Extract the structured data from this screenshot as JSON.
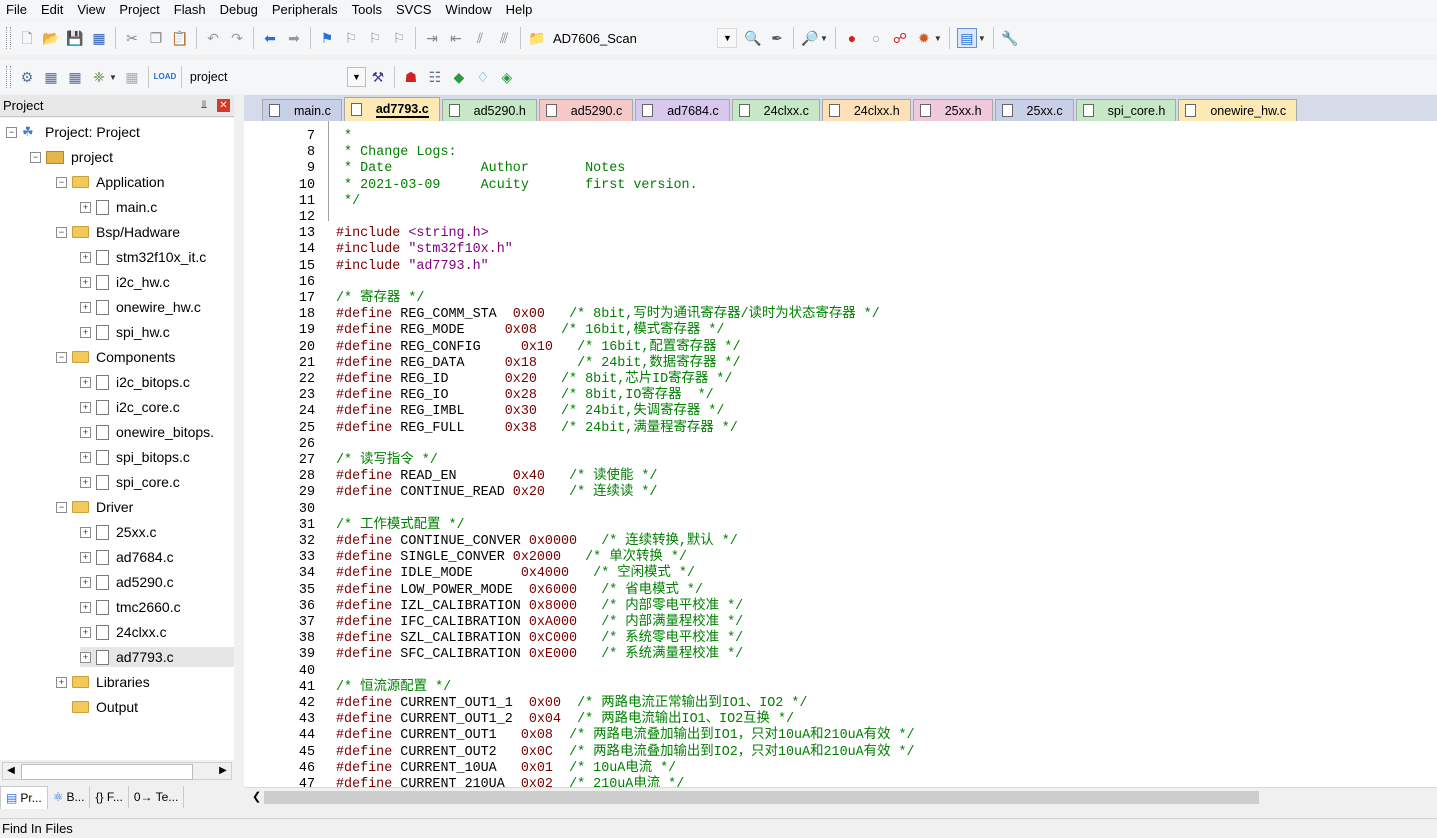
{
  "menu": [
    "File",
    "Edit",
    "View",
    "Project",
    "Flash",
    "Debug",
    "Peripherals",
    "Tools",
    "SVCS",
    "Window",
    "Help"
  ],
  "toolbar1": {
    "target_combo": "AD7606_Scan"
  },
  "toolbar2": {
    "project_combo": "project"
  },
  "project_panel": {
    "title": "Project",
    "pin": "҉",
    "close": "✕",
    "tree": [
      {
        "label": "Project: Project",
        "level": 0,
        "kind": "proj",
        "exp": "−"
      },
      {
        "label": "project",
        "level": 1,
        "kind": "group",
        "exp": "−"
      },
      {
        "label": "Application",
        "level": 2,
        "kind": "folder",
        "exp": "−"
      },
      {
        "label": "main.c",
        "level": 3,
        "kind": "file",
        "exp": "+"
      },
      {
        "label": "Bsp/Hadware",
        "level": 2,
        "kind": "folder",
        "exp": "−"
      },
      {
        "label": "stm32f10x_it.c",
        "level": 3,
        "kind": "file",
        "exp": "+"
      },
      {
        "label": "i2c_hw.c",
        "level": 3,
        "kind": "file",
        "exp": "+"
      },
      {
        "label": "onewire_hw.c",
        "level": 3,
        "kind": "file",
        "exp": "+"
      },
      {
        "label": "spi_hw.c",
        "level": 3,
        "kind": "file",
        "exp": "+"
      },
      {
        "label": "Components",
        "level": 2,
        "kind": "folder",
        "exp": "−"
      },
      {
        "label": "i2c_bitops.c",
        "level": 3,
        "kind": "file",
        "exp": "+"
      },
      {
        "label": "i2c_core.c",
        "level": 3,
        "kind": "file",
        "exp": "+"
      },
      {
        "label": "onewire_bitops.",
        "level": 3,
        "kind": "file",
        "exp": "+"
      },
      {
        "label": "spi_bitops.c",
        "level": 3,
        "kind": "file",
        "exp": "+"
      },
      {
        "label": "spi_core.c",
        "level": 3,
        "kind": "file",
        "exp": "+"
      },
      {
        "label": "Driver",
        "level": 2,
        "kind": "folder",
        "exp": "−"
      },
      {
        "label": "25xx.c",
        "level": 3,
        "kind": "file",
        "exp": "+"
      },
      {
        "label": "ad7684.c",
        "level": 3,
        "kind": "file",
        "exp": "+"
      },
      {
        "label": "ad5290.c",
        "level": 3,
        "kind": "file",
        "exp": "+"
      },
      {
        "label": "tmc2660.c",
        "level": 3,
        "kind": "file",
        "exp": "+"
      },
      {
        "label": "24clxx.c",
        "level": 3,
        "kind": "file",
        "exp": "+"
      },
      {
        "label": "ad7793.c",
        "level": 3,
        "kind": "file",
        "exp": "+",
        "selected": true
      },
      {
        "label": "Libraries",
        "level": 2,
        "kind": "folder",
        "exp": "+"
      },
      {
        "label": "Output",
        "level": 2,
        "kind": "folder",
        "exp": ""
      }
    ],
    "bottom_tabs": [
      "Pr...",
      "B...",
      "{} F...",
      "0→ Te..."
    ]
  },
  "editor": {
    "tabs": [
      {
        "label": "main.c",
        "color": "#c7d0e6",
        "active": false
      },
      {
        "label": "ad7793.c",
        "color": "#fde9b4",
        "active": true
      },
      {
        "label": "ad5290.h",
        "color": "#c6e8c6",
        "active": false
      },
      {
        "label": "ad5290.c",
        "color": "#f6c8c8",
        "active": false
      },
      {
        "label": "ad7684.c",
        "color": "#d9c8ee",
        "active": false
      },
      {
        "label": "24clxx.c",
        "color": "#c6e8c6",
        "active": false
      },
      {
        "label": "24clxx.h",
        "color": "#fde0b8",
        "active": false
      },
      {
        "label": "25xx.h",
        "color": "#f0c8dc",
        "active": false
      },
      {
        "label": "25xx.c",
        "color": "#c7d0e6",
        "active": false
      },
      {
        "label": "spi_core.h",
        "color": "#c6e8c6",
        "active": false
      },
      {
        "label": "onewire_hw.c",
        "color": "#fde9b4",
        "active": false
      }
    ],
    "lines": [
      {
        "n": "7",
        "t": " *",
        "c": "cmt"
      },
      {
        "n": "8",
        "t": " * Change Logs:",
        "c": "cmt"
      },
      {
        "n": "9",
        "t": " * Date           Author       Notes",
        "c": "cmt"
      },
      {
        "n": "10",
        "t": " * 2021-03-09     Acuity       first version.",
        "c": "cmt"
      },
      {
        "n": "11",
        "t": " */",
        "c": "cmt"
      },
      {
        "n": "12",
        "t": "",
        "c": ""
      },
      {
        "n": "13",
        "t": "#include <string.h>",
        "c": "inc"
      },
      {
        "n": "14",
        "t": "#include \"stm32f10x.h\"",
        "c": "inc"
      },
      {
        "n": "15",
        "t": "#include \"ad7793.h\"",
        "c": "inc"
      },
      {
        "n": "16",
        "t": "",
        "c": ""
      },
      {
        "n": "17",
        "t": "/* 寄存器 */",
        "c": "cmt"
      },
      {
        "n": "18",
        "t": "#define REG_COMM_STA  0x00   /* 8bit,写时为通讯寄存器/读时为状态寄存器 */",
        "c": "def"
      },
      {
        "n": "19",
        "t": "#define REG_MODE     0x08   /* 16bit,模式寄存器 */",
        "c": "def"
      },
      {
        "n": "20",
        "t": "#define REG_CONFIG     0x10   /* 16bit,配置寄存器 */",
        "c": "def"
      },
      {
        "n": "21",
        "t": "#define REG_DATA     0x18     /* 24bit,数据寄存器 */",
        "c": "def"
      },
      {
        "n": "22",
        "t": "#define REG_ID       0x20   /* 8bit,芯片ID寄存器 */",
        "c": "def"
      },
      {
        "n": "23",
        "t": "#define REG_IO       0x28   /* 8bit,IO寄存器  */",
        "c": "def"
      },
      {
        "n": "24",
        "t": "#define REG_IMBL     0x30   /* 24bit,失调寄存器 */",
        "c": "def"
      },
      {
        "n": "25",
        "t": "#define REG_FULL     0x38   /* 24bit,满量程寄存器 */",
        "c": "def"
      },
      {
        "n": "26",
        "t": "",
        "c": ""
      },
      {
        "n": "27",
        "t": "/* 读写指令 */",
        "c": "cmt"
      },
      {
        "n": "28",
        "t": "#define READ_EN       0x40   /* 读使能 */",
        "c": "def"
      },
      {
        "n": "29",
        "t": "#define CONTINUE_READ 0x20   /* 连续读 */",
        "c": "def"
      },
      {
        "n": "30",
        "t": "",
        "c": ""
      },
      {
        "n": "31",
        "t": "/* 工作模式配置 */",
        "c": "cmt"
      },
      {
        "n": "32",
        "t": "#define CONTINUE_CONVER 0x0000   /* 连续转换,默认 */",
        "c": "def"
      },
      {
        "n": "33",
        "t": "#define SINGLE_CONVER 0x2000   /* 单次转换 */",
        "c": "def"
      },
      {
        "n": "34",
        "t": "#define IDLE_MODE      0x4000   /* 空闲模式 */",
        "c": "def"
      },
      {
        "n": "35",
        "t": "#define LOW_POWER_MODE  0x6000   /* 省电模式 */",
        "c": "def"
      },
      {
        "n": "36",
        "t": "#define IZL_CALIBRATION 0x8000   /* 内部零电平校准 */",
        "c": "def"
      },
      {
        "n": "37",
        "t": "#define IFC_CALIBRATION 0xA000   /* 内部满量程校准 */",
        "c": "def"
      },
      {
        "n": "38",
        "t": "#define SZL_CALIBRATION 0xC000   /* 系统零电平校准 */",
        "c": "def"
      },
      {
        "n": "39",
        "t": "#define SFC_CALIBRATION 0xE000   /* 系统满量程校准 */",
        "c": "def"
      },
      {
        "n": "40",
        "t": "",
        "c": ""
      },
      {
        "n": "41",
        "t": "/* 恒流源配置 */",
        "c": "cmt"
      },
      {
        "n": "42",
        "t": "#define CURRENT_OUT1_1  0x00  /* 两路电流正常输出到IO1、IO2 */",
        "c": "def"
      },
      {
        "n": "43",
        "t": "#define CURRENT_OUT1_2  0x04  /* 两路电流输出IO1、IO2互换 */",
        "c": "def"
      },
      {
        "n": "44",
        "t": "#define CURRENT_OUT1   0x08  /* 两路电流叠加输出到IO1，只对10uA和210uA有效 */",
        "c": "def"
      },
      {
        "n": "45",
        "t": "#define CURRENT_OUT2   0x0C  /* 两路电流叠加输出到IO2，只对10uA和210uA有效 */",
        "c": "def"
      },
      {
        "n": "46",
        "t": "#define CURRENT_10UA   0x01  /* 10uA电流 */",
        "c": "def"
      },
      {
        "n": "47",
        "t": "#define CURRENT_210UA  0x02  /* 210uA电流 */",
        "c": "def"
      }
    ]
  },
  "status_bar": "Find In Files"
}
